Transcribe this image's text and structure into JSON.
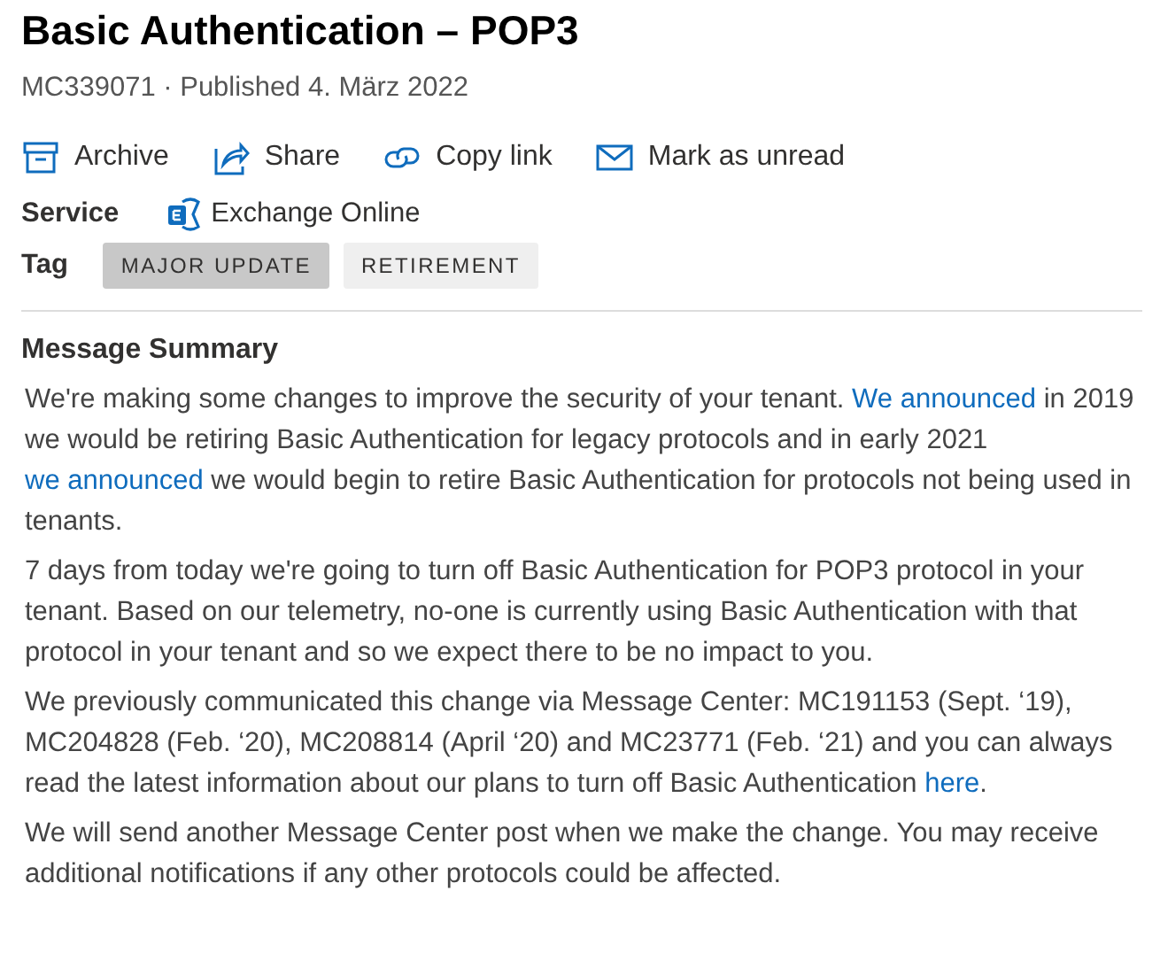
{
  "title": "Basic Authentication – POP3",
  "subtitle": "MC339071 · Published 4. März 2022",
  "actions": [
    {
      "kind": "archive",
      "label": "Archive"
    },
    {
      "kind": "share",
      "label": "Share"
    },
    {
      "kind": "link",
      "label": "Copy link"
    },
    {
      "kind": "mail",
      "label": "Mark as unread"
    }
  ],
  "service": {
    "label": "Service",
    "value": "Exchange Online"
  },
  "tags": {
    "label": "Tag",
    "items": [
      {
        "label": "MAJOR UPDATE",
        "selected": true
      },
      {
        "label": "RETIREMENT",
        "selected": false
      }
    ]
  },
  "summary": {
    "heading": "Message Summary",
    "paragraphs": [
      [
        {
          "kind": "text",
          "text": "We're making some changes to improve the security of your tenant. "
        },
        {
          "kind": "link",
          "text": "We announced"
        },
        {
          "kind": "text",
          "text": " in 2019 we would be retiring Basic Authentication for legacy protocols and in early 2021 "
        },
        {
          "kind": "link",
          "text": "we announced"
        },
        {
          "kind": "text",
          "text": " we would begin to retire Basic Authentication for protocols not being used in tenants."
        }
      ],
      [
        {
          "kind": "text",
          "text": "7 days from today we're going to turn off Basic Authentication for POP3 protocol in your tenant. Based on our telemetry, no-one is currently using Basic Authentication with that protocol in your tenant and so we expect there to be no impact to you."
        }
      ],
      [
        {
          "kind": "text",
          "text": "We previously communicated this change via Message Center: MC191153 (Sept. ‘19), MC204828 (Feb. ‘20), MC208814 (April ‘20) and MC23771 (Feb. ‘21) and you can always read the latest information about our plans to turn off Basic Authentication "
        },
        {
          "kind": "link",
          "text": "here"
        },
        {
          "kind": "text",
          "text": "."
        }
      ],
      [
        {
          "kind": "text",
          "text": "We will send another Message Center post when we make the change. You may receive additional notifications if any other protocols could be affected."
        }
      ]
    ]
  }
}
